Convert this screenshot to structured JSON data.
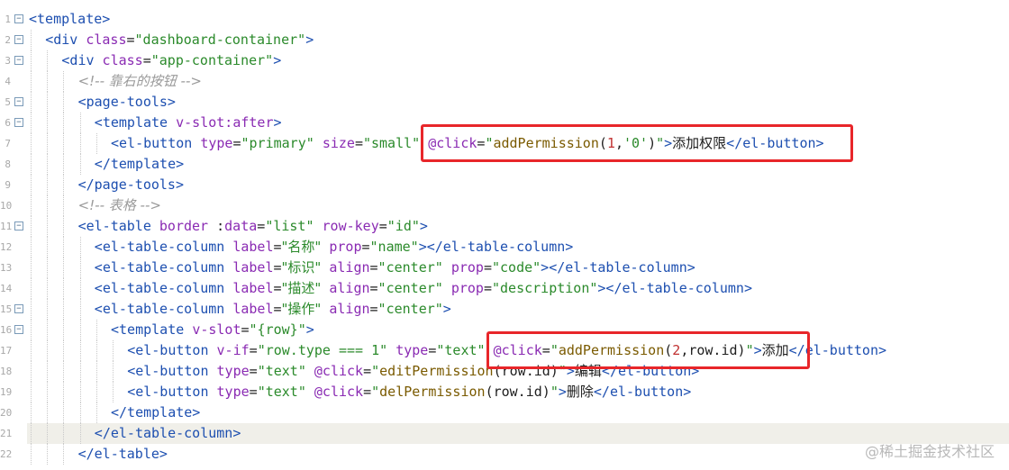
{
  "editor": {
    "lines": [
      {
        "n": "1",
        "fold": "⊟",
        "indent": 0,
        "tokens": [
          [
            "tag",
            "<template>"
          ]
        ]
      },
      {
        "n": "2",
        "fold": "⊟",
        "indent": 1,
        "tokens": [
          [
            "tag",
            "<div "
          ],
          [
            "attr",
            "class"
          ],
          [
            "txt",
            "="
          ],
          [
            "str",
            "\"dashboard-container\""
          ],
          [
            "tag",
            ">"
          ]
        ]
      },
      {
        "n": "3",
        "fold": "⊟",
        "indent": 2,
        "tokens": [
          [
            "tag",
            "<div "
          ],
          [
            "attr",
            "class"
          ],
          [
            "txt",
            "="
          ],
          [
            "str",
            "\"app-container\""
          ],
          [
            "tag",
            ">"
          ]
        ]
      },
      {
        "n": "4",
        "fold": "",
        "indent": 3,
        "tokens": [
          [
            "cmt",
            "<!-- 靠右的按钮 -->"
          ]
        ]
      },
      {
        "n": "5",
        "fold": "⊟",
        "indent": 3,
        "tokens": [
          [
            "tag",
            "<page-tools>"
          ]
        ]
      },
      {
        "n": "6",
        "fold": "⊟",
        "indent": 4,
        "tokens": [
          [
            "tag",
            "<template "
          ],
          [
            "attr",
            "v-slot:after"
          ],
          [
            "tag",
            ">"
          ]
        ]
      },
      {
        "n": "7",
        "fold": "",
        "indent": 5,
        "tokens": [
          [
            "tag",
            "<el-button "
          ],
          [
            "attr",
            "type"
          ],
          [
            "txt",
            "="
          ],
          [
            "str",
            "\"primary\""
          ],
          [
            "txt",
            " "
          ],
          [
            "attr",
            "size"
          ],
          [
            "txt",
            "="
          ],
          [
            "str",
            "\"small\""
          ],
          [
            "txt",
            " "
          ],
          [
            "attr",
            "@click"
          ],
          [
            "txt",
            "="
          ],
          [
            "str",
            "\""
          ],
          [
            "fn",
            "addPermission"
          ],
          [
            "txt",
            "("
          ],
          [
            "num",
            "1"
          ],
          [
            "txt",
            ","
          ],
          [
            "str",
            "'0'"
          ],
          [
            "txt",
            ")"
          ],
          [
            "str",
            "\""
          ],
          [
            "tag",
            ">"
          ],
          [
            "txt",
            "添加权限"
          ],
          [
            "tag",
            "</el-button>"
          ]
        ]
      },
      {
        "n": "8",
        "fold": "",
        "indent": 4,
        "tokens": [
          [
            "tag",
            "</template>"
          ]
        ]
      },
      {
        "n": "9",
        "fold": "",
        "indent": 3,
        "tokens": [
          [
            "tag",
            "</page-tools>"
          ]
        ]
      },
      {
        "n": "10",
        "fold": "",
        "indent": 3,
        "tokens": [
          [
            "cmt",
            "<!-- 表格 -->"
          ]
        ]
      },
      {
        "n": "11",
        "fold": "⊟",
        "indent": 3,
        "tokens": [
          [
            "tag",
            "<el-table "
          ],
          [
            "attr",
            "border"
          ],
          [
            "txt",
            " :"
          ],
          [
            "attr",
            "data"
          ],
          [
            "txt",
            "="
          ],
          [
            "str",
            "\"list\""
          ],
          [
            "txt",
            " "
          ],
          [
            "attr",
            "row-key"
          ],
          [
            "txt",
            "="
          ],
          [
            "str",
            "\"id\""
          ],
          [
            "tag",
            ">"
          ]
        ]
      },
      {
        "n": "12",
        "fold": "",
        "indent": 4,
        "tokens": [
          [
            "tag",
            "<el-table-column "
          ],
          [
            "attr",
            "label"
          ],
          [
            "txt",
            "="
          ],
          [
            "str",
            "\"名称\""
          ],
          [
            "txt",
            " "
          ],
          [
            "attr",
            "prop"
          ],
          [
            "txt",
            "="
          ],
          [
            "str",
            "\"name\""
          ],
          [
            "tag",
            "></el-table-column>"
          ]
        ]
      },
      {
        "n": "13",
        "fold": "",
        "indent": 4,
        "tokens": [
          [
            "tag",
            "<el-table-column "
          ],
          [
            "attr",
            "label"
          ],
          [
            "txt",
            "="
          ],
          [
            "str",
            "\"标识\""
          ],
          [
            "txt",
            " "
          ],
          [
            "attr",
            "align"
          ],
          [
            "txt",
            "="
          ],
          [
            "str",
            "\"center\""
          ],
          [
            "txt",
            " "
          ],
          [
            "attr",
            "prop"
          ],
          [
            "txt",
            "="
          ],
          [
            "str",
            "\"code\""
          ],
          [
            "tag",
            "></el-table-column>"
          ]
        ]
      },
      {
        "n": "14",
        "fold": "",
        "indent": 4,
        "tokens": [
          [
            "tag",
            "<el-table-column "
          ],
          [
            "attr",
            "label"
          ],
          [
            "txt",
            "="
          ],
          [
            "str",
            "\"描述\""
          ],
          [
            "txt",
            " "
          ],
          [
            "attr",
            "align"
          ],
          [
            "txt",
            "="
          ],
          [
            "str",
            "\"center\""
          ],
          [
            "txt",
            " "
          ],
          [
            "attr",
            "prop"
          ],
          [
            "txt",
            "="
          ],
          [
            "str",
            "\"description\""
          ],
          [
            "tag",
            "></el-table-column>"
          ]
        ]
      },
      {
        "n": "15",
        "fold": "⊟",
        "indent": 4,
        "tokens": [
          [
            "tag",
            "<el-table-column "
          ],
          [
            "attr",
            "label"
          ],
          [
            "txt",
            "="
          ],
          [
            "str",
            "\"操作\""
          ],
          [
            "txt",
            " "
          ],
          [
            "attr",
            "align"
          ],
          [
            "txt",
            "="
          ],
          [
            "str",
            "\"center\""
          ],
          [
            "tag",
            ">"
          ]
        ]
      },
      {
        "n": "16",
        "fold": "⊟",
        "indent": 5,
        "tokens": [
          [
            "tag",
            "<template "
          ],
          [
            "attr",
            "v-slot"
          ],
          [
            "txt",
            "="
          ],
          [
            "str",
            "\"{row}\""
          ],
          [
            "tag",
            ">"
          ]
        ]
      },
      {
        "n": "17",
        "fold": "",
        "indent": 6,
        "tokens": [
          [
            "tag",
            "<el-button "
          ],
          [
            "attr",
            "v-if"
          ],
          [
            "txt",
            "="
          ],
          [
            "str",
            "\"row.type === 1\""
          ],
          [
            "txt",
            " "
          ],
          [
            "attr",
            "type"
          ],
          [
            "txt",
            "="
          ],
          [
            "str",
            "\"text\""
          ],
          [
            "txt",
            " "
          ],
          [
            "attr",
            "@click"
          ],
          [
            "txt",
            "="
          ],
          [
            "str",
            "\""
          ],
          [
            "fn",
            "addPermission"
          ],
          [
            "txt",
            "("
          ],
          [
            "num",
            "2"
          ],
          [
            "txt",
            ",row.id)"
          ],
          [
            "str",
            "\""
          ],
          [
            "tag",
            ">"
          ],
          [
            "txt",
            "添加"
          ],
          [
            "tag",
            "</el-button>"
          ]
        ]
      },
      {
        "n": "18",
        "fold": "",
        "indent": 6,
        "tokens": [
          [
            "tag",
            "<el-button "
          ],
          [
            "attr",
            "type"
          ],
          [
            "txt",
            "="
          ],
          [
            "str",
            "\"text\""
          ],
          [
            "txt",
            " "
          ],
          [
            "attr",
            "@click"
          ],
          [
            "txt",
            "="
          ],
          [
            "str",
            "\""
          ],
          [
            "fn",
            "editPermission"
          ],
          [
            "txt",
            "(row.id)"
          ],
          [
            "str",
            "\""
          ],
          [
            "tag",
            ">"
          ],
          [
            "txt",
            "编辑"
          ],
          [
            "tag",
            "</el-button>"
          ]
        ]
      },
      {
        "n": "19",
        "fold": "",
        "indent": 6,
        "tokens": [
          [
            "tag",
            "<el-button "
          ],
          [
            "attr",
            "type"
          ],
          [
            "txt",
            "="
          ],
          [
            "str",
            "\"text\""
          ],
          [
            "txt",
            " "
          ],
          [
            "attr",
            "@click"
          ],
          [
            "txt",
            "="
          ],
          [
            "str",
            "\""
          ],
          [
            "fn",
            "delPermission"
          ],
          [
            "txt",
            "(row.id)"
          ],
          [
            "str",
            "\""
          ],
          [
            "tag",
            ">"
          ],
          [
            "txt",
            "删除"
          ],
          [
            "tag",
            "</el-button>"
          ]
        ]
      },
      {
        "n": "20",
        "fold": "",
        "indent": 5,
        "tokens": [
          [
            "tag",
            "</template>"
          ]
        ]
      },
      {
        "n": "21",
        "fold": "",
        "indent": 4,
        "highlight": true,
        "tokens": [
          [
            "tag",
            "</el-table-column>"
          ]
        ]
      },
      {
        "n": "22",
        "fold": "",
        "indent": 3,
        "tokens": [
          [
            "tag",
            "</el-table>"
          ]
        ]
      }
    ],
    "annotations": [
      {
        "label": "@click=\"addPermission(1,'0')\""
      },
      {
        "label": "@click=\"addPermission(2,row.id)\""
      }
    ],
    "watermark": "@稀土掘金技术社区"
  },
  "colors": {
    "tag": "#1d4fb0",
    "attr": "#8a2bb3",
    "string": "#2b8a2b",
    "function": "#7a5a00",
    "comment": "#9a9a9a",
    "highlight_box": "#e8262a"
  }
}
